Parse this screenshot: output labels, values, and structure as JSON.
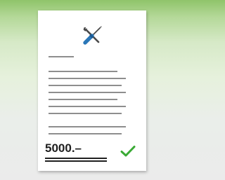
{
  "document": {
    "icon": "wrench-screwdriver-icon",
    "price_text": "5000.–",
    "status_icon": "checkmark-icon"
  },
  "colors": {
    "background_top": "#8fc46a",
    "paper": "#ffffff",
    "text_lines": "#8e8e8e",
    "price_text": "#1f1f1f",
    "checkmark": "#3aaa35",
    "screwdriver_handle": "#2b77b8",
    "wrench": "#4a4a4a"
  }
}
